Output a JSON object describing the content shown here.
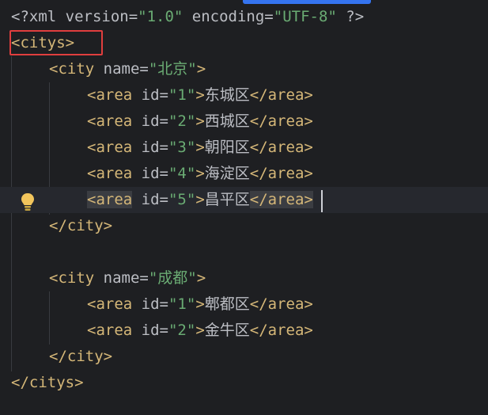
{
  "editor": {
    "lines": [
      {
        "parts": [
          [
            "pi",
            "<?xml version="
          ],
          [
            "str",
            "\"1.0\""
          ],
          [
            "pi",
            " encoding="
          ],
          [
            "str",
            "\"UTF-8\""
          ],
          [
            "pi",
            " ?>"
          ]
        ]
      },
      {
        "parts": [
          [
            "tag",
            "<citys>"
          ]
        ]
      },
      {
        "parts": [
          [
            "tag",
            "<city "
          ],
          [
            "attr",
            "name"
          ],
          [
            "eq",
            "="
          ],
          [
            "str",
            "\"北京\""
          ],
          [
            "tag",
            ">"
          ]
        ]
      },
      {
        "parts": [
          [
            "tag",
            "<area "
          ],
          [
            "attr",
            "id"
          ],
          [
            "eq",
            "="
          ],
          [
            "str",
            "\"1\""
          ],
          [
            "tag",
            ">"
          ],
          [
            "txt",
            "东城区"
          ],
          [
            "tag",
            "</area>"
          ]
        ]
      },
      {
        "parts": [
          [
            "tag",
            "<area "
          ],
          [
            "attr",
            "id"
          ],
          [
            "eq",
            "="
          ],
          [
            "str",
            "\"2\""
          ],
          [
            "tag",
            ">"
          ],
          [
            "txt",
            "西城区"
          ],
          [
            "tag",
            "</area>"
          ]
        ]
      },
      {
        "parts": [
          [
            "tag",
            "<area "
          ],
          [
            "attr",
            "id"
          ],
          [
            "eq",
            "="
          ],
          [
            "str",
            "\"3\""
          ],
          [
            "tag",
            ">"
          ],
          [
            "txt",
            "朝阳区"
          ],
          [
            "tag",
            "</area>"
          ]
        ]
      },
      {
        "parts": [
          [
            "tag",
            "<area "
          ],
          [
            "attr",
            "id"
          ],
          [
            "eq",
            "="
          ],
          [
            "str",
            "\"4\""
          ],
          [
            "tag",
            ">"
          ],
          [
            "txt",
            "海淀区"
          ],
          [
            "tag",
            "</area>"
          ]
        ]
      },
      {
        "parts": [
          [
            "tag",
            "<area"
          ],
          [
            "attr",
            " id"
          ],
          [
            "eq",
            "="
          ],
          [
            "str",
            "\"5\""
          ],
          [
            "tag",
            ">"
          ],
          [
            "txt",
            "昌平区"
          ],
          [
            "tag",
            "</area>"
          ]
        ]
      },
      {
        "parts": [
          [
            "tag",
            "</city>"
          ]
        ]
      },
      {
        "parts": []
      },
      {
        "parts": [
          [
            "tag",
            "<city "
          ],
          [
            "attr",
            "name"
          ],
          [
            "eq",
            "="
          ],
          [
            "str",
            "\"成都\""
          ],
          [
            "tag",
            ">"
          ]
        ]
      },
      {
        "parts": [
          [
            "tag",
            "<area "
          ],
          [
            "attr",
            "id"
          ],
          [
            "eq",
            "="
          ],
          [
            "str",
            "\"1\""
          ],
          [
            "tag",
            ">"
          ],
          [
            "txt",
            "郫都区"
          ],
          [
            "tag",
            "</area>"
          ]
        ]
      },
      {
        "parts": [
          [
            "tag",
            "<area "
          ],
          [
            "attr",
            "id"
          ],
          [
            "eq",
            "="
          ],
          [
            "str",
            "\"2\""
          ],
          [
            "tag",
            ">"
          ],
          [
            "txt",
            "金牛区"
          ],
          [
            "tag",
            "</area>"
          ]
        ]
      },
      {
        "parts": [
          [
            "tag",
            "</city>"
          ]
        ]
      },
      {
        "parts": [
          [
            "tag",
            "</citys>"
          ]
        ]
      }
    ]
  },
  "icons": {
    "intention": "lightbulb-icon"
  },
  "colors": {
    "background": "#1e1f22",
    "tag": "#d5b778",
    "string": "#6aab73",
    "text": "#bcbec4",
    "highlight_box": "#e03e3e",
    "accent": "#3574f0"
  }
}
